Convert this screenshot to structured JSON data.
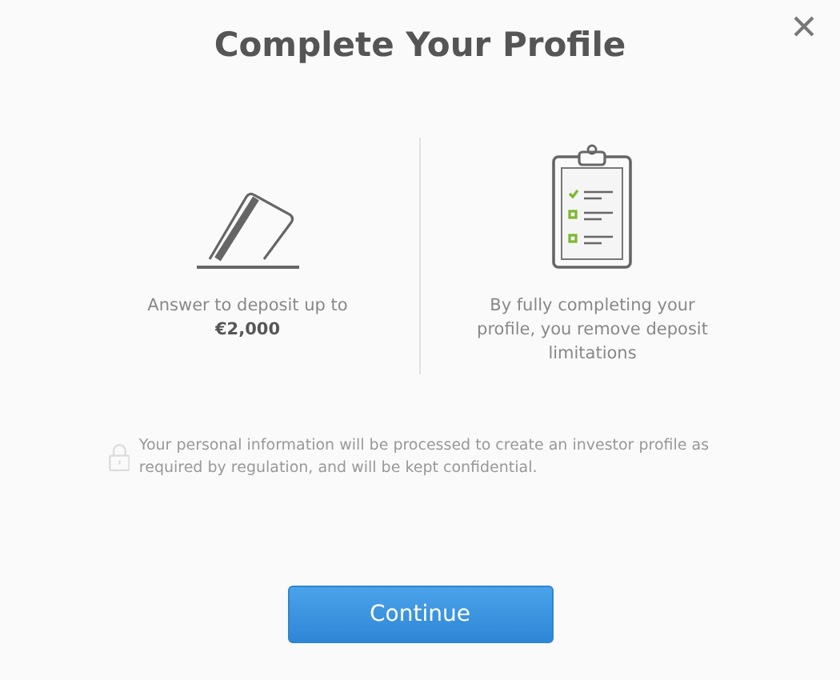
{
  "dialog": {
    "title": "Complete Your Profile",
    "options": [
      {
        "kind": "card",
        "text": "Answer to deposit up to **€2,000**"
      },
      {
        "kind": "checklist",
        "text": "By fully completing your profile, you remove deposit limitations"
      }
    ],
    "notice": "Your personal information will be processed to create an investor profile as required by regulation, and will be kept confidential.",
    "button": "Continue"
  }
}
